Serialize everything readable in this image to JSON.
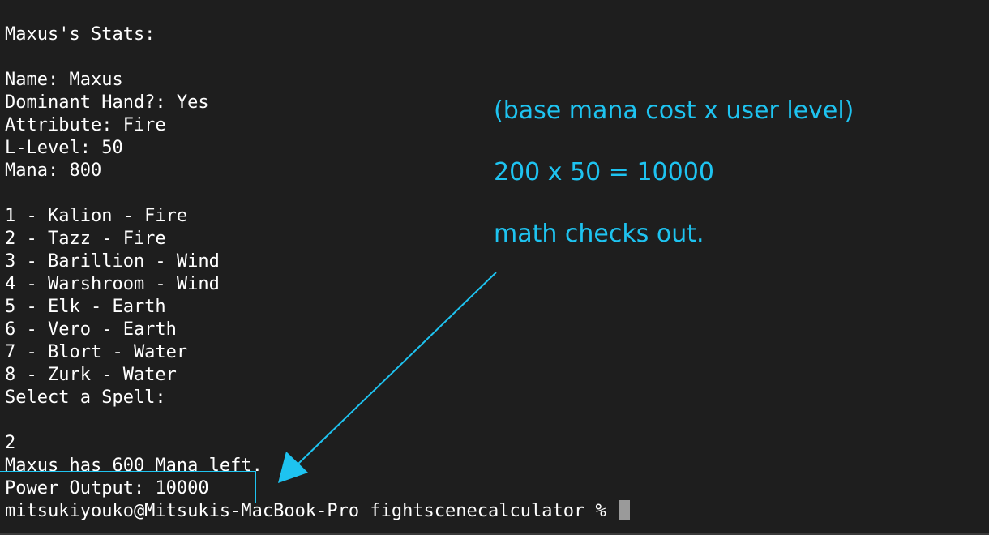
{
  "terminal": {
    "lines": [
      "",
      "Maxus's Stats:",
      "",
      "Name: Maxus",
      "Dominant Hand?: Yes",
      "Attribute: Fire",
      "L-Level: 50",
      "Mana: 800",
      "",
      "1 - Kalion - Fire",
      "2 - Tazz - Fire",
      "3 - Barillion - Wind",
      "4 - Warshroom - Wind",
      "5 - Elk - Earth",
      "6 - Vero - Earth",
      "7 - Blort - Water",
      "8 - Zurk - Water",
      "Select a Spell:",
      "",
      "2",
      "Maxus has 600 Mana left.",
      "Power Output: 10000"
    ],
    "prompt": "mitsukiyouko@Mitsukis-MacBook-Pro fightscenecalculator % "
  },
  "annotation": {
    "formula": "(base mana cost x user level)",
    "calculation": "200 x 50 = 10000",
    "remark": "math checks out.",
    "color": "#1ec3f0"
  },
  "colors": {
    "background": "#1e1e1e",
    "text": "#ffffff",
    "cursor": "#9a9a9a"
  }
}
